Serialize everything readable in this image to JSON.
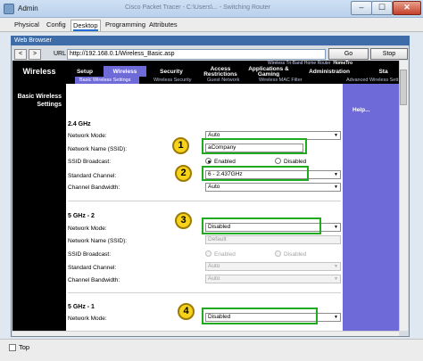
{
  "window": {
    "title": "Admin",
    "ghost_title": "Cisco Packet Tracer - C:\\Users\\... - Switching Router"
  },
  "window_buttons": {
    "minimize": "–",
    "maximize": "☐",
    "close": "✕"
  },
  "tabs": [
    {
      "label": "Physical"
    },
    {
      "label": "Config"
    },
    {
      "label": "Desktop"
    },
    {
      "label": "Programming"
    },
    {
      "label": "Attributes"
    }
  ],
  "browser": {
    "title": "Web Browser",
    "back": "<",
    "forward": ">",
    "url_label": "URL",
    "url": "http://192.168.0.1/Wireless_Basic.asp",
    "go": "Go",
    "stop": "Stop"
  },
  "router": {
    "brand": "Wireless",
    "model": "Wireless Tri-Band Home Router",
    "model_short": "HomeTro",
    "nav": [
      "Setup",
      "Wireless",
      "Security",
      "Access Restrictions",
      "Applications & Gaming",
      "Administration",
      "Sta"
    ],
    "subnav": [
      "Basic Wireless Settings",
      "Wireless Security",
      "Guest Network",
      "Wireless MAC Filter",
      "Advanced Wireless Sett"
    ],
    "side_title": "Basic Wireless Settings",
    "help": "Help..."
  },
  "sections": {
    "s24": {
      "title": "2.4 GHz",
      "network_mode_label": "Network Mode:",
      "network_mode": "Auto",
      "ssid_label": "Network Name (SSID):",
      "ssid": "aCompany",
      "broadcast_label": "SSID Broadcast:",
      "enabled": "Enabled",
      "disabled": "Disabled",
      "channel_label": "Standard Channel:",
      "channel": "6 - 2.437GHz",
      "bandwidth_label": "Channel Bandwidth:",
      "bandwidth": "Auto"
    },
    "s5_2": {
      "title": "5 GHz - 2",
      "network_mode_label": "Network Mode:",
      "network_mode": "Disabled",
      "ssid_label": "Network Name (SSID):",
      "ssid": "Default",
      "broadcast_label": "SSID Broadcast:",
      "enabled": "Enabled",
      "disabled": "Disabled",
      "channel_label": "Standard Channel:",
      "channel": "Auto",
      "bandwidth_label": "Channel Bandwidth:",
      "bandwidth": "Auto"
    },
    "s5_1": {
      "title": "5 GHz - 1",
      "network_mode_label": "Network Mode:",
      "network_mode": "Disabled"
    }
  },
  "annotations": [
    "1",
    "2",
    "3",
    "4"
  ],
  "bottom": {
    "top_label": "Top"
  },
  "arrow": "▼"
}
